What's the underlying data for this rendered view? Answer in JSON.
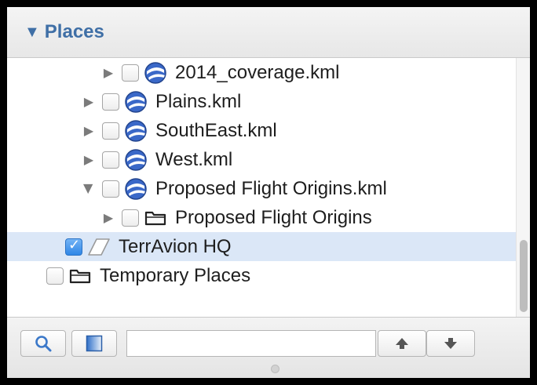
{
  "panel": {
    "title": "Places",
    "icons": {
      "collapse": "triangle-down-icon",
      "kml": "globe-icon",
      "folder": "folder-icon",
      "placemark": "placemark-icon"
    }
  },
  "tree": {
    "items": [
      {
        "label": "2014_coverage.kml",
        "checked": false,
        "icon": "globe-icon",
        "expanded": false
      },
      {
        "label": "Plains.kml",
        "checked": false,
        "icon": "globe-icon",
        "expanded": false
      },
      {
        "label": "SouthEast.kml",
        "checked": false,
        "icon": "globe-icon",
        "expanded": false
      },
      {
        "label": "West.kml",
        "checked": false,
        "icon": "globe-icon",
        "expanded": false
      },
      {
        "label": "Proposed Flight Origins.kml",
        "checked": false,
        "icon": "globe-icon",
        "expanded": true
      },
      {
        "label": "Proposed Flight Origins",
        "checked": false,
        "icon": "folder-icon",
        "expanded": false
      },
      {
        "label": "TerrAvion HQ",
        "checked": true,
        "icon": "placemark-icon",
        "selected": true
      },
      {
        "label": "Temporary Places",
        "checked": false,
        "icon": "folder-icon"
      }
    ]
  },
  "toolbar": {
    "search_placeholder": "",
    "search_value": "",
    "buttons": [
      "search-icon",
      "sidebar-toggle-icon",
      "move-up-icon",
      "move-down-icon"
    ]
  },
  "colors": {
    "accent": "#3f6fa6",
    "selection": "#dbe7f7",
    "checked": "#2f86e6"
  }
}
